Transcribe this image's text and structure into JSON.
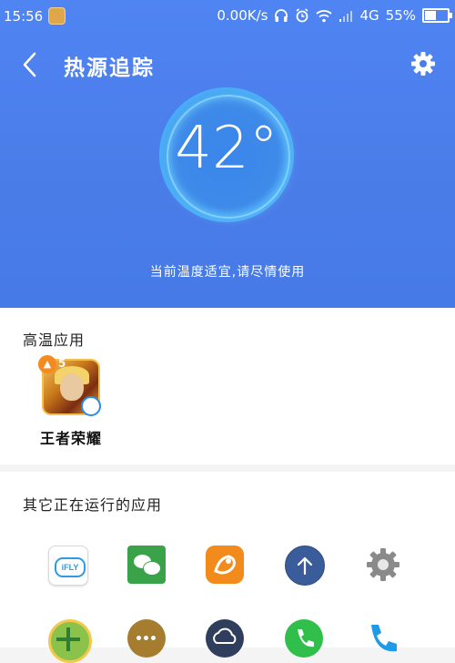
{
  "status_bar": {
    "time": "15:56",
    "net_speed": "0.00K/s",
    "network": "4G",
    "battery": "55%",
    "battery_level": 0.55
  },
  "header": {
    "title": "热源追踪",
    "temperature": "42°",
    "status_text": "当前温度适宜,请尽情使用"
  },
  "hot_apps": {
    "section_title": "高温应用",
    "items": [
      {
        "name": "王者荣耀",
        "icon": "honor-of-kings-icon",
        "badge": "5"
      }
    ]
  },
  "running_apps": {
    "section_title": "其它正在运行的应用",
    "items": [
      {
        "icon": "ifly-icon",
        "icon_text": "iFLY"
      },
      {
        "icon": "wechat-icon"
      },
      {
        "icon": "uc-browser-icon"
      },
      {
        "icon": "upload-arrow-icon"
      },
      {
        "icon": "settings-gear-icon"
      },
      {
        "icon": "green-plus-icon"
      },
      {
        "icon": "more-dots-icon"
      },
      {
        "icon": "cloud-icon"
      },
      {
        "icon": "phone-green-icon"
      },
      {
        "icon": "phone-blue-icon"
      }
    ]
  },
  "colors": {
    "header_blue": "#4b7de9",
    "accent_ring": "#8cd7ff"
  }
}
